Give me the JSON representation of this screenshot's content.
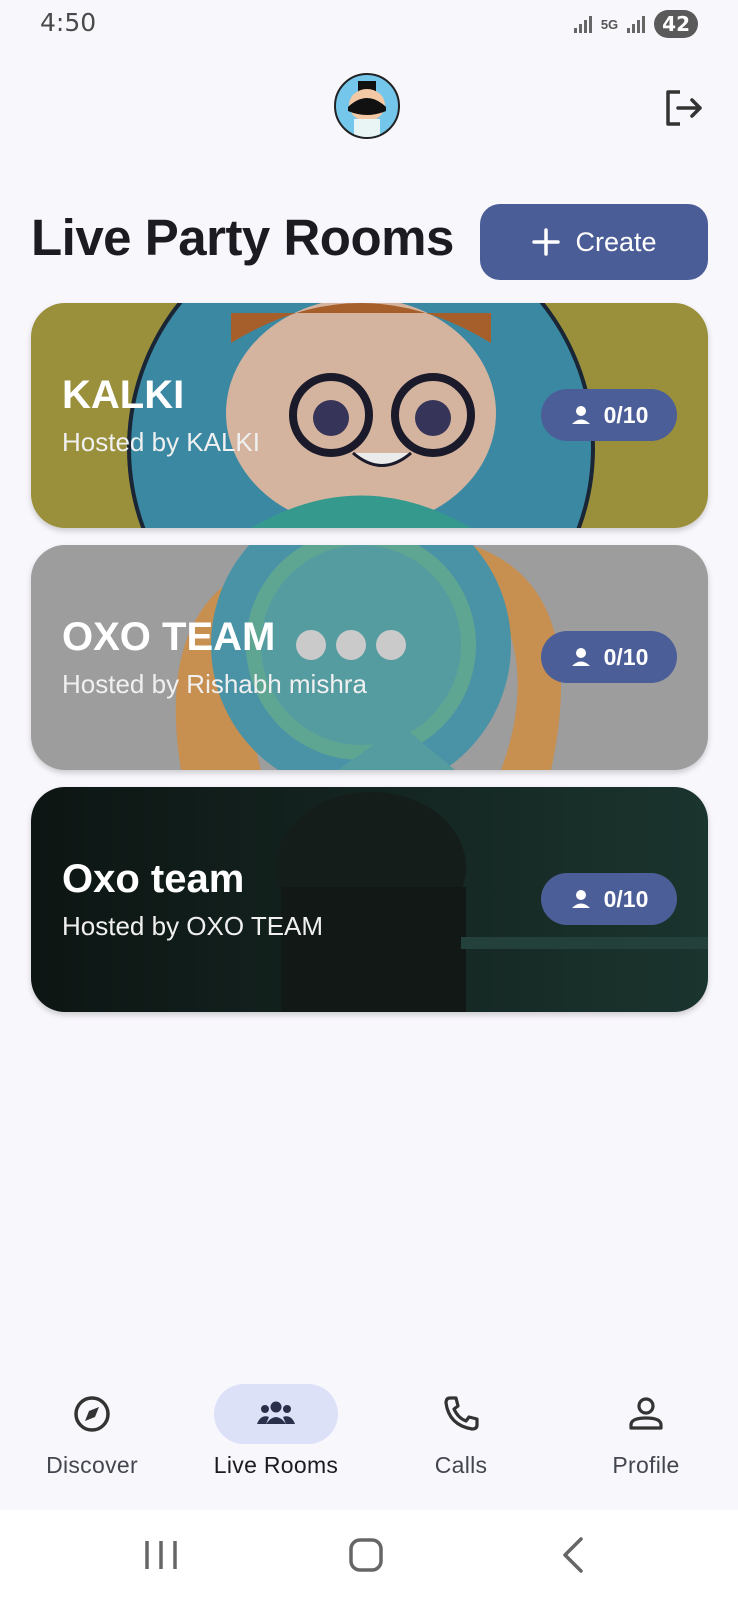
{
  "status_bar": {
    "time": "4:50",
    "network": "5G",
    "battery": "42"
  },
  "header": {
    "avatar_alt": "user-avatar",
    "logout_icon": "logout-icon"
  },
  "page": {
    "title": "Live Party Rooms",
    "create_label": "Create"
  },
  "rooms": [
    {
      "name": "KALKI",
      "host": "Hosted by KALKI",
      "occupancy": "0/10",
      "bg_color": "#a89c3f"
    },
    {
      "name": "OXO TEAM",
      "host": "Hosted by Rishabh mishra",
      "occupancy": "0/10",
      "bg_color": "#9c9c9c"
    },
    {
      "name": "Oxo team",
      "host": "Hosted by OXO TEAM",
      "occupancy": "0/10",
      "bg_color": "#0f1a18"
    }
  ],
  "bottom_nav": {
    "items": [
      {
        "label": "Discover",
        "icon": "compass-icon"
      },
      {
        "label": "Live Rooms",
        "icon": "group-icon",
        "active": true
      },
      {
        "label": "Calls",
        "icon": "phone-icon"
      },
      {
        "label": "Profile",
        "icon": "person-icon"
      }
    ]
  },
  "colors": {
    "accent": "#4a5d96",
    "active_pill": "#dde1f8",
    "background": "#f8f7fc"
  }
}
